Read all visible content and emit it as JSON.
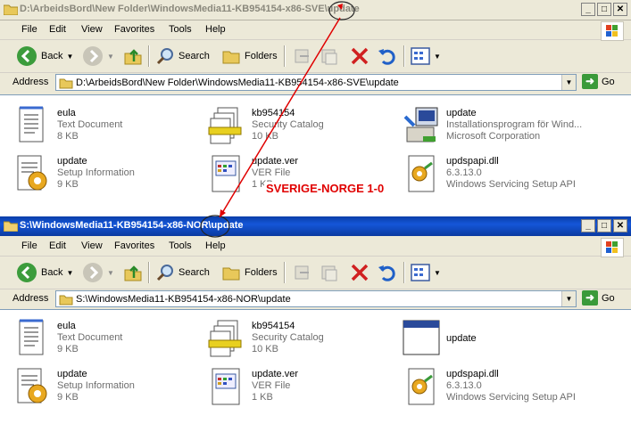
{
  "win1": {
    "title": "D:\\ArbeidsBord\\New Folder\\WindowsMedia11-KB954154-x86-SVE\\update",
    "menu": [
      "File",
      "Edit",
      "View",
      "Favorites",
      "Tools",
      "Help"
    ],
    "toolbar": {
      "back": "Back",
      "search": "Search",
      "folders": "Folders"
    },
    "address_label": "Address",
    "address": "D:\\ArbeidsBord\\New Folder\\WindowsMedia11-KB954154-x86-SVE\\update",
    "go": "Go",
    "files": [
      {
        "name": "eula",
        "line2": "Text Document",
        "line3": "8 KB",
        "icon": "text-document-icon"
      },
      {
        "name": "kb954154",
        "line2": "Security Catalog",
        "line3": "10 KB",
        "icon": "security-catalog-icon"
      },
      {
        "name": "update",
        "line2": "Installationsprogram för Wind...",
        "line3": "Microsoft Corporation",
        "icon": "installer-icon"
      },
      {
        "name": "update",
        "line2": "Setup Information",
        "line3": "9 KB",
        "icon": "setup-information-icon"
      },
      {
        "name": "update.ver",
        "line2": "VER File",
        "line3": "1 KB",
        "icon": "ver-file-icon"
      },
      {
        "name": "updspapi.dll",
        "line2": "6.3.13.0",
        "line3": "Windows Servicing Setup API",
        "icon": "dll-icon"
      }
    ]
  },
  "win2": {
    "title": "S:\\WindowsMedia11-KB954154-x86-NOR\\update",
    "menu": [
      "File",
      "Edit",
      "View",
      "Favorites",
      "Tools",
      "Help"
    ],
    "toolbar": {
      "back": "Back",
      "search": "Search",
      "folders": "Folders"
    },
    "address_label": "Address",
    "address": "S:\\WindowsMedia11-KB954154-x86-NOR\\update",
    "go": "Go",
    "files": [
      {
        "name": "eula",
        "line2": "Text Document",
        "line3": "9 KB",
        "icon": "text-document-icon"
      },
      {
        "name": "kb954154",
        "line2": "Security Catalog",
        "line3": "10 KB",
        "icon": "security-catalog-icon"
      },
      {
        "name": "update",
        "line2": "",
        "line3": "",
        "icon": "application-window-icon"
      },
      {
        "name": "update",
        "line2": "Setup Information",
        "line3": "9 KB",
        "icon": "setup-information-icon"
      },
      {
        "name": "update.ver",
        "line2": "VER File",
        "line3": "1 KB",
        "icon": "ver-file-icon"
      },
      {
        "name": "updspapi.dll",
        "line2": "6.3.13.0",
        "line3": "Windows Servicing Setup API",
        "icon": "dll-icon"
      }
    ]
  },
  "annotation": {
    "text": "SVERIGE-NORGE 1-0",
    "color": "#e00000"
  }
}
